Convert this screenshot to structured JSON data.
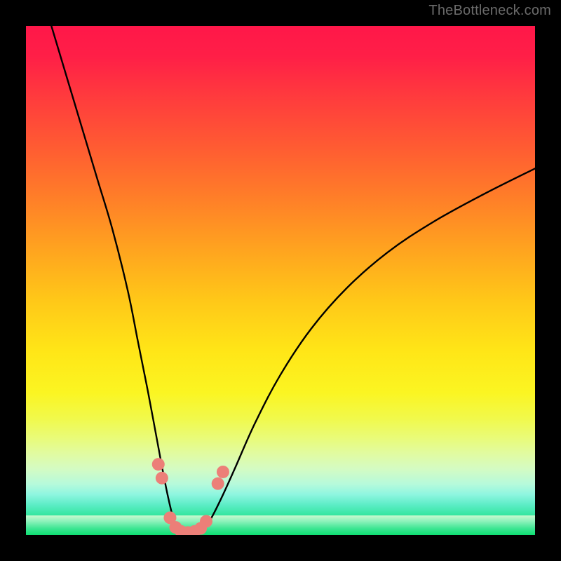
{
  "watermark": "TheBottleneck.com",
  "chart_data": {
    "type": "line",
    "title": "",
    "xlabel": "",
    "ylabel": "",
    "xlim": [
      0,
      100
    ],
    "ylim": [
      0,
      100
    ],
    "background_gradient": {
      "direction": "vertical",
      "stops": [
        {
          "pos": 0,
          "color": "#ff1749"
        },
        {
          "pos": 50,
          "color": "#ffd818"
        },
        {
          "pos": 80,
          "color": "#f3f94f"
        },
        {
          "pos": 100,
          "color": "#0fe073"
        }
      ]
    },
    "series": [
      {
        "name": "left-branch",
        "color": "#000000",
        "x": [
          5,
          8,
          11,
          14,
          17,
          20,
          22,
          24,
          25.5,
          26.8,
          27.8,
          28.6,
          29.2,
          29.6,
          30
        ],
        "y": [
          100,
          90,
          80,
          70,
          60,
          48,
          38,
          28,
          20,
          13,
          8,
          4.5,
          2.3,
          1,
          0.3
        ]
      },
      {
        "name": "right-branch",
        "color": "#000000",
        "x": [
          34,
          35,
          36.5,
          38.5,
          41,
          45,
          50,
          56,
          63,
          71,
          80,
          90,
          100
        ],
        "y": [
          0.3,
          1.2,
          3.5,
          7.5,
          13,
          22,
          31.5,
          40.5,
          48.5,
          55.5,
          61.5,
          67,
          72
        ]
      },
      {
        "name": "valley-floor",
        "color": "#000000",
        "x": [
          30,
          31,
          32,
          33,
          34
        ],
        "y": [
          0.3,
          0.1,
          0.08,
          0.1,
          0.3
        ]
      }
    ],
    "markers": [
      {
        "name": "left-upper-dot-1",
        "x": 26.0,
        "y": 13.9,
        "color": "#ec7f78",
        "r": 9
      },
      {
        "name": "left-upper-dot-2",
        "x": 26.7,
        "y": 11.2,
        "color": "#ec7f78",
        "r": 9
      },
      {
        "name": "right-upper-dot-1",
        "x": 37.7,
        "y": 10.1,
        "color": "#ec7f78",
        "r": 9
      },
      {
        "name": "right-upper-dot-2",
        "x": 38.7,
        "y": 12.4,
        "color": "#ec7f78",
        "r": 9
      },
      {
        "name": "valley-dot-1",
        "x": 28.3,
        "y": 3.4,
        "color": "#ec7f78",
        "r": 9
      },
      {
        "name": "valley-dot-2",
        "x": 29.4,
        "y": 1.5,
        "color": "#ec7f78",
        "r": 9
      },
      {
        "name": "valley-dot-3",
        "x": 30.5,
        "y": 0.7,
        "color": "#ec7f78",
        "r": 9
      },
      {
        "name": "valley-dot-4",
        "x": 31.8,
        "y": 0.5,
        "color": "#ec7f78",
        "r": 9
      },
      {
        "name": "valley-dot-5",
        "x": 33.1,
        "y": 0.7,
        "color": "#ec7f78",
        "r": 9
      },
      {
        "name": "valley-dot-6",
        "x": 34.3,
        "y": 1.3,
        "color": "#ec7f78",
        "r": 9
      },
      {
        "name": "valley-dot-7",
        "x": 35.4,
        "y": 2.7,
        "color": "#ec7f78",
        "r": 9
      }
    ]
  }
}
